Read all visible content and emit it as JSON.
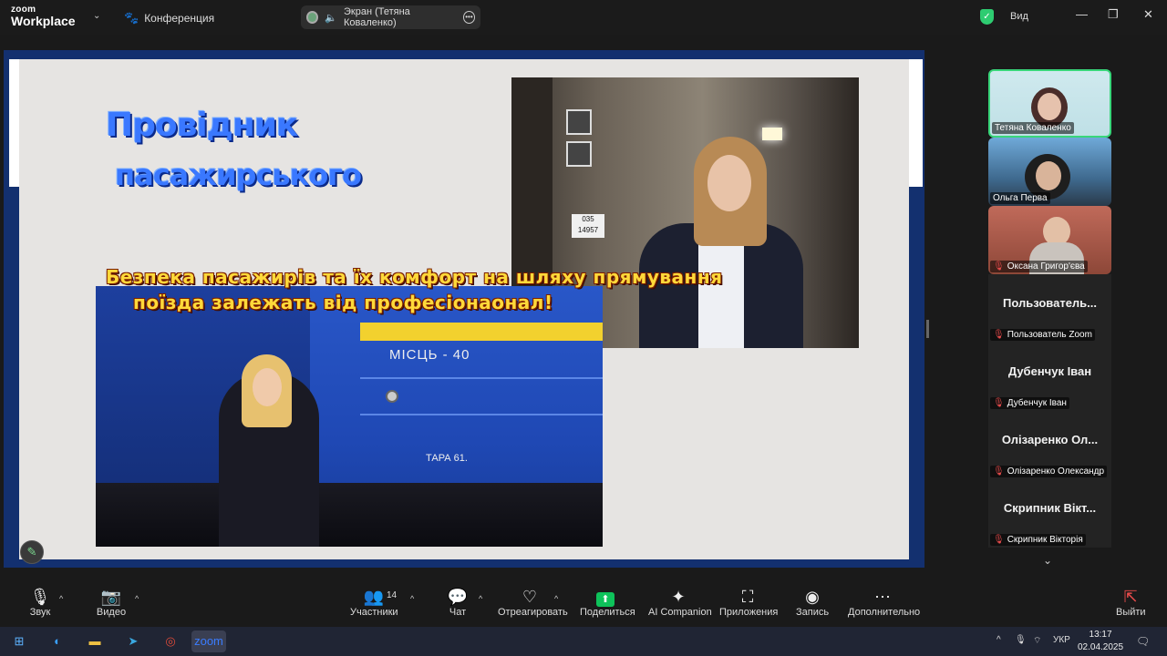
{
  "titlebar": {
    "brand_line1": "zoom",
    "brand_line2": "Workplace",
    "meeting_label": "Конференция",
    "share_label": "Экран (Тетяна  Коваленко)",
    "view_label": "Вид",
    "minimize": "—",
    "maximize": "❐",
    "close": "✕"
  },
  "slide": {
    "title_line1": "Провідник",
    "title_line2": "пасажирського",
    "subtitle_line1": "Безпека  пасажирів  та  їх  комфорт  на шляху прямування",
    "subtitle_line2": "поїзда  залежать від  професіонаонал!",
    "photo_top_plate": "035\n14957",
    "photo_bottom_label1": "МІСЦЬ - 40",
    "photo_bottom_label2": "ТАРА 61."
  },
  "participants": [
    {
      "name": "Тетяна  Коваленко",
      "video": true,
      "active": true,
      "muted": false
    },
    {
      "name": "Ольга Перва",
      "video": true,
      "active": false,
      "muted": false
    },
    {
      "name": "Оксана Григор'єва",
      "video": true,
      "active": false,
      "muted": true
    },
    {
      "name": "Пользователь Zoom",
      "display": "Пользователь...",
      "video": false,
      "muted": true
    },
    {
      "name": "Дубенчук Іван",
      "display": "Дубенчук Іван",
      "video": false,
      "muted": true
    },
    {
      "name": "Олізаренко Олександр",
      "display": "Олізаренко Ол...",
      "video": false,
      "muted": true
    },
    {
      "name": "Скрипник Вікторія",
      "display": "Скрипник Вікт...",
      "video": false,
      "muted": true
    }
  ],
  "toolbar": {
    "audio": "Звук",
    "video": "Видео",
    "participants": "Участники",
    "participants_count": "14",
    "chat": "Чат",
    "react": "Отреагировать",
    "share": "Поделиться",
    "ai": "AI Companion",
    "apps": "Приложения",
    "record": "Запись",
    "more": "Дополнительно",
    "leave": "Выйти"
  },
  "taskbar": {
    "language": "УКР",
    "time": "13:17",
    "date": "02.04.2025"
  },
  "colors": {
    "accent_green": "#39d67a",
    "share_green": "#0ec25a",
    "slide_bg": "#e6e4e2",
    "stage_blue": "#13306f"
  },
  "icons": [
    "zoom-logo",
    "paw-icon",
    "speaker-icon",
    "more-icon",
    "shield-icon",
    "mic-icon",
    "camera-icon",
    "people-icon",
    "chat-icon",
    "heart-icon",
    "share-screen-icon",
    "sparkle-icon",
    "apps-icon",
    "record-icon",
    "ellipsis-icon",
    "leave-icon",
    "pencil-icon"
  ]
}
